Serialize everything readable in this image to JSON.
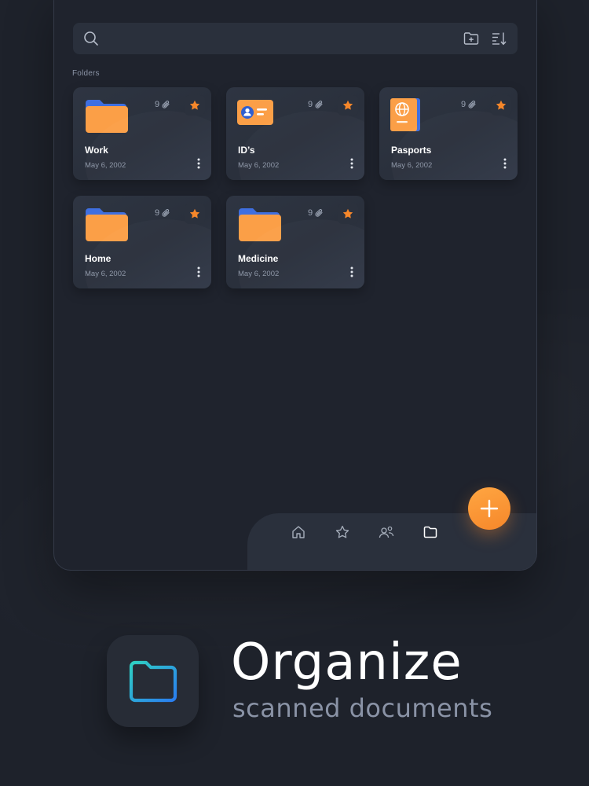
{
  "search": {
    "placeholder": ""
  },
  "section": {
    "folders_label": "Folders"
  },
  "folders": [
    {
      "name": "Work",
      "date": "May 6, 2002",
      "count": "9",
      "icon": "folder-icon"
    },
    {
      "name": "ID’s",
      "date": "May 6, 2002",
      "count": "9",
      "icon": "id-card-icon"
    },
    {
      "name": "Pasports",
      "date": "May 6, 2002",
      "count": "9",
      "icon": "passport-icon"
    },
    {
      "name": "Home",
      "date": "May 6, 2002",
      "count": "9",
      "icon": "folder-icon"
    },
    {
      "name": "Medicine",
      "date": "May 6, 2002",
      "count": "9",
      "icon": "folder-icon"
    }
  ],
  "nav": [
    "home-icon",
    "star-icon",
    "people-icon",
    "folder-icon"
  ],
  "promo": {
    "title": "Organize",
    "subtitle": "scanned documents"
  },
  "colors": {
    "background": "#1e222b",
    "card": "#2a303c",
    "accent": "#f6872a",
    "star": "#f6872a",
    "icon_gradient_start": "#2fd0c2",
    "icon_gradient_end": "#2a7df0"
  }
}
